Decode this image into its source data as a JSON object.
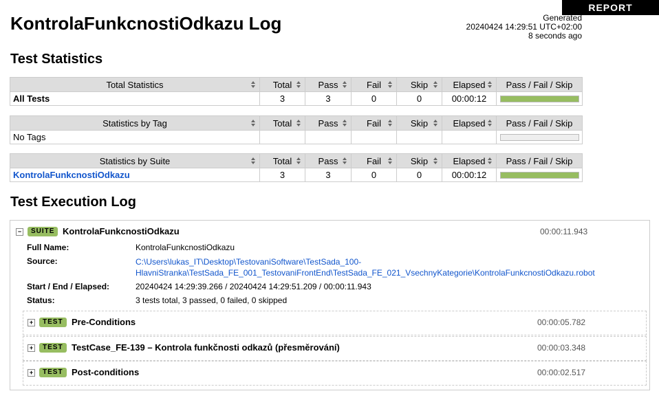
{
  "header": {
    "title": "KontrolaFunkcnostiOdkazu Log",
    "report_button": "REPORT",
    "generated_label": "Generated",
    "generated_time": "20240424 14:29:51 UTC+02:00",
    "generated_ago": "8 seconds ago"
  },
  "statistics": {
    "heading": "Test Statistics",
    "columns": [
      "Total",
      "Pass",
      "Fail",
      "Skip",
      "Elapsed",
      "Pass / Fail / Skip"
    ],
    "total": {
      "header": "Total Statistics",
      "row": {
        "name": "All Tests",
        "total": "3",
        "pass": "3",
        "fail": "0",
        "skip": "0",
        "elapsed": "00:00:12",
        "pass_fraction": 1.0
      }
    },
    "by_tag": {
      "header": "Statistics by Tag",
      "row": {
        "name": "No Tags",
        "total": "",
        "pass": "",
        "fail": "",
        "skip": "",
        "elapsed": "",
        "pass_fraction": 0
      }
    },
    "by_suite": {
      "header": "Statistics by Suite",
      "row": {
        "name": "KontrolaFunkcnostiOdkazu",
        "total": "3",
        "pass": "3",
        "fail": "0",
        "skip": "0",
        "elapsed": "00:00:12",
        "pass_fraction": 1.0
      }
    }
  },
  "execution_log": {
    "heading": "Test Execution Log",
    "suite": {
      "toggle": "−",
      "label": "SUITE",
      "name": "KontrolaFunkcnostiOdkazu",
      "elapsed": "00:00:11.943",
      "full_name_label": "Full Name:",
      "full_name": "KontrolaFunkcnostiOdkazu",
      "source_label": "Source:",
      "source_line1": "C:\\Users\\lukas_IT\\Desktop\\TestovaniSoftware\\TestSada_100-",
      "source_line2": "HlavniStranka\\TestSada_FE_001_TestovaniFrontEnd\\TestSada_FE_021_VsechnyKategorie\\KontrolaFunkcnostiOdkazu.robot",
      "times_label": "Start / End / Elapsed:",
      "times": "20240424 14:29:39.266 / 20240424 14:29:51.209 / 00:00:11.943",
      "status_label": "Status:",
      "status": "3 tests total, 3 passed, 0 failed, 0 skipped"
    },
    "tests": [
      {
        "toggle": "+",
        "label": "TEST",
        "name": "Pre-Conditions",
        "elapsed": "00:00:05.782"
      },
      {
        "toggle": "+",
        "label": "TEST",
        "name": "TestCase_FE-139 – Kontrola funkčnosti odkazů (přesměrování)",
        "elapsed": "00:00:03.348"
      },
      {
        "toggle": "+",
        "label": "TEST",
        "name": "Post-conditions",
        "elapsed": "00:00:02.517"
      }
    ]
  },
  "colors": {
    "pass": "#97bd61",
    "link": "#1155cc",
    "header_bg": "#dddddd"
  }
}
